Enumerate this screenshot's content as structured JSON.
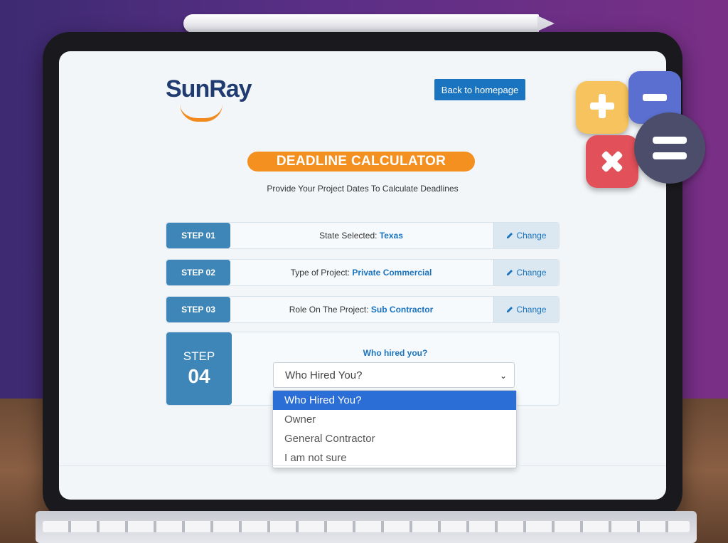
{
  "logo": {
    "text": "SunRay"
  },
  "header": {
    "back_label": "Back to homepage"
  },
  "title": "DEADLINE CALCULATOR",
  "subtitle": "Provide Your Project Dates To Calculate Deadlines",
  "steps": [
    {
      "label": "STEP 01",
      "prefix": "State Selected: ",
      "value": "Texas",
      "change": "Change"
    },
    {
      "label": "STEP 02",
      "prefix": "Type of Project: ",
      "value": "Private Commercial",
      "change": "Change"
    },
    {
      "label": "STEP 03",
      "prefix": "Role On The Project: ",
      "value": "Sub Contractor",
      "change": "Change"
    }
  ],
  "step4": {
    "label_word": "STEP",
    "label_num": "04",
    "question": "Who hired you?",
    "select_value": "Who Hired You?",
    "options": [
      "Who Hired You?",
      "Owner",
      "General Contractor",
      "I am not sure"
    ]
  },
  "icons": {
    "calculator": "calculator-icon",
    "pencil": "pencil-icon",
    "chevron": "chevron-down-icon"
  },
  "colors": {
    "accent": "#1b74c0",
    "orange": "#f4901f",
    "step": "#3f86b8"
  }
}
